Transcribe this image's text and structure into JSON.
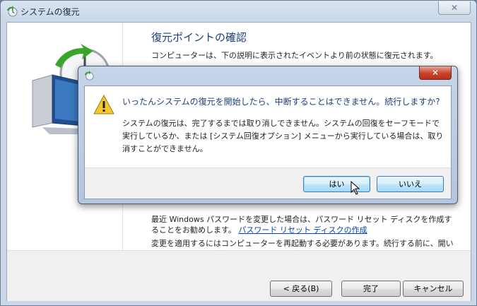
{
  "window": {
    "title": "システムの復元",
    "close_icon": "close-icon"
  },
  "page": {
    "heading": "復元ポイントの確認",
    "description": "コンピューターは、下の説明に表示されたイベントより前の状態に復元されます。",
    "password_note_1": "最近 Windows パスワードを変更した場合は、パスワード リセット ディスクを作成することをお勧めします。",
    "password_link": "パスワード リセット ディスクの作成",
    "restart_note": "変更を適用するにはコンピューターを再起動する必要があります。続行する前に、開いているファイルを保存し、すべてのプログラムを閉じてください。"
  },
  "footer": {
    "back": "< 戻る(B)",
    "finish": "完了",
    "cancel": "キャンセル"
  },
  "dialog": {
    "main_instruction": "いったんシステムの復元を開始したら、中断することはできません。続行しますか?",
    "body": "システムの復元は、完了するまでは取り消しできません。システムの回復をセーフモードで実行しているか、または [システム回復オプション] メニューから実行している場合は、取り消すことができません。",
    "yes": "はい",
    "no": "いいえ"
  },
  "colors": {
    "heading": "#1d3f7a",
    "link": "#0645ad",
    "dialog_close": "#c7412b"
  }
}
